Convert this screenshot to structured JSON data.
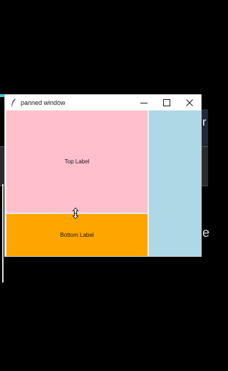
{
  "window": {
    "title": "panned window",
    "controls": {
      "minimize": "minimize-icon",
      "maximize": "maximize-icon",
      "close": "close-icon"
    }
  },
  "panes": {
    "top": {
      "label": "Top Label",
      "color": "#ffc0cb"
    },
    "bottom": {
      "label": "Bottom Label",
      "color": "#ffa500"
    },
    "right": {
      "color": "#add8e6"
    }
  },
  "desktop": {
    "right_glyph": "e",
    "right_glyph_top": "r"
  }
}
